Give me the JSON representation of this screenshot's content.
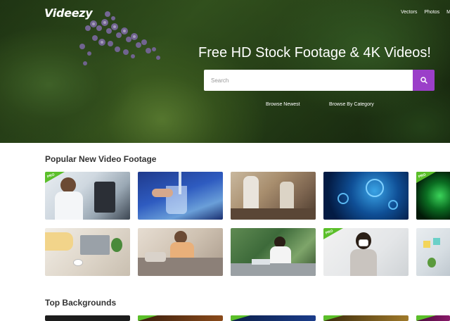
{
  "header": {
    "logo": "Videezy",
    "nav": [
      "Vectors",
      "Photos",
      "Mo"
    ]
  },
  "hero": {
    "headline": "Free HD Stock Footage & 4K Videos!",
    "search_placeholder": "Search",
    "browse_newest": "Browse Newest",
    "browse_category": "Browse By Category"
  },
  "sections": {
    "popular_title": "Popular New Video Footage",
    "backgrounds_title": "Top Backgrounds"
  },
  "badge_label": "PRO",
  "colors": {
    "accent": "#9b3fc9",
    "pro_badge": "#5bbf2a"
  }
}
